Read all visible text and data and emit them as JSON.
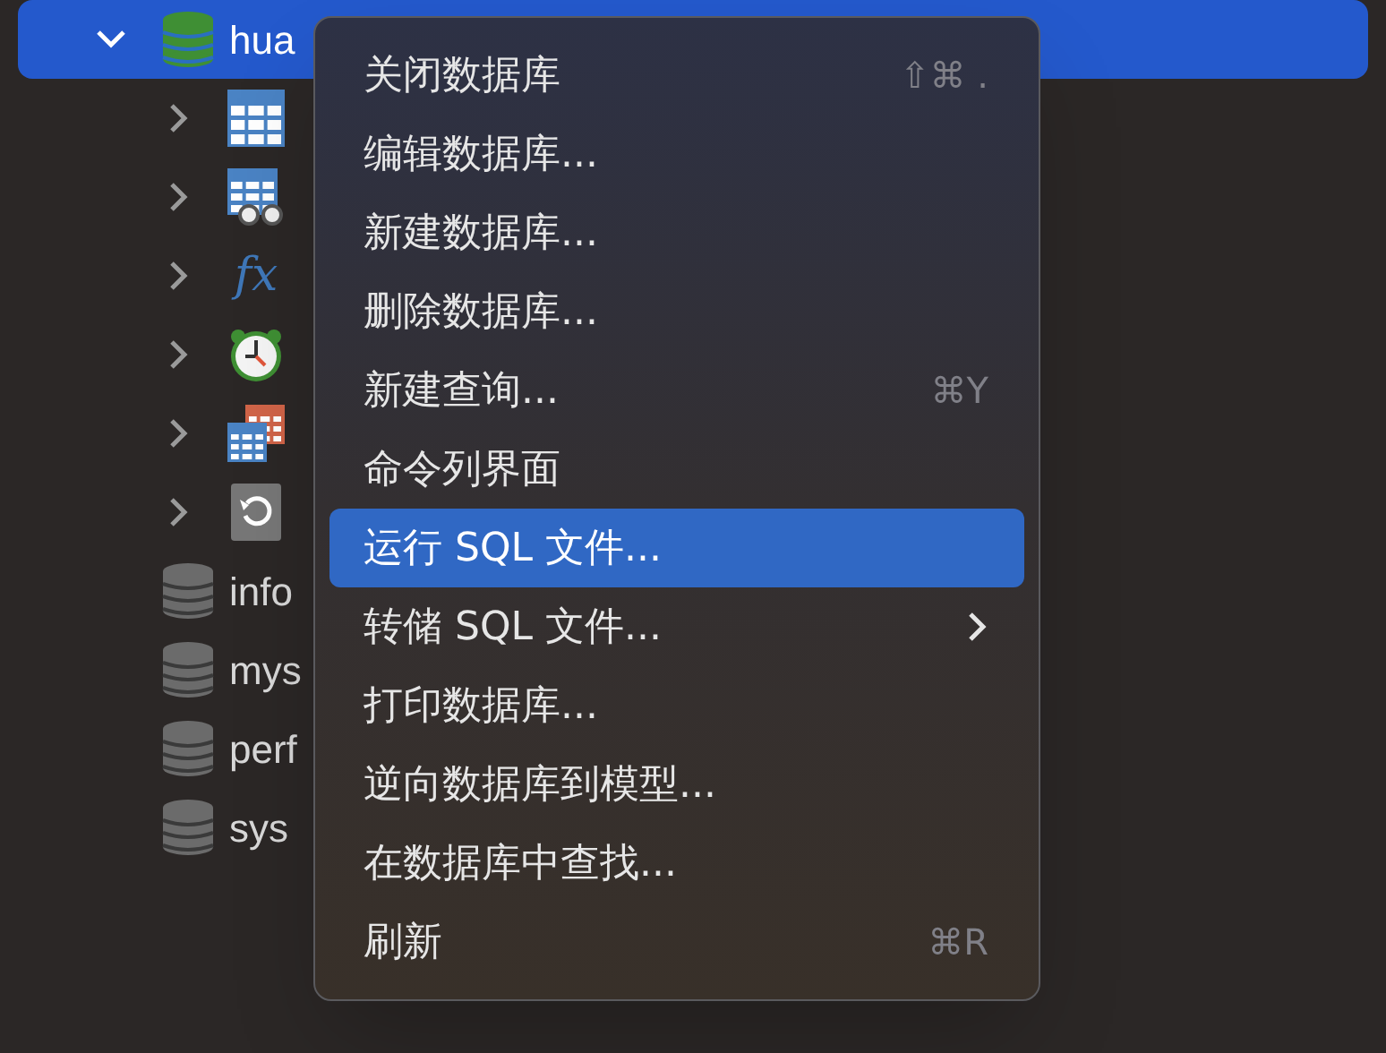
{
  "tree": [
    {
      "label": "hua",
      "open": true,
      "selected": true,
      "children": [
        {
          "kind": "tables",
          "expanded": false
        },
        {
          "kind": "views",
          "expanded": false
        },
        {
          "kind": "functions",
          "glyph": "fx",
          "expanded": false
        },
        {
          "kind": "events",
          "expanded": false
        },
        {
          "kind": "queries",
          "expanded": false
        },
        {
          "kind": "backups",
          "expanded": false
        }
      ]
    },
    {
      "label": "info",
      "open": false,
      "selected": false
    },
    {
      "label": "mys",
      "open": false,
      "selected": false
    },
    {
      "label": "perf",
      "open": false,
      "selected": false
    },
    {
      "label": "sys",
      "open": false,
      "selected": false
    }
  ],
  "context_menu": {
    "items": [
      {
        "label": "关闭数据库",
        "shortcut": "⇧⌘ .",
        "kind": "item",
        "selected": false
      },
      {
        "label": "编辑数据库...",
        "kind": "item",
        "selected": false
      },
      {
        "label": "新建数据库...",
        "kind": "item",
        "selected": false
      },
      {
        "label": "删除数据库...",
        "kind": "item",
        "selected": false
      },
      {
        "label": "新建查询...",
        "shortcut": "⌘Y",
        "kind": "item",
        "selected": false
      },
      {
        "label": "命令列界面",
        "kind": "item",
        "selected": false
      },
      {
        "label": "运行 SQL 文件...",
        "kind": "item",
        "selected": true
      },
      {
        "label": "转储 SQL 文件...",
        "kind": "submenu",
        "selected": false
      },
      {
        "label": "打印数据库...",
        "kind": "item",
        "selected": false
      },
      {
        "label": "逆向数据库到模型...",
        "kind": "item",
        "selected": false
      },
      {
        "label": "在数据库中查找...",
        "kind": "item",
        "selected": false
      },
      {
        "label": "刷新",
        "shortcut": "⌘R",
        "kind": "item",
        "selected": false
      }
    ]
  }
}
